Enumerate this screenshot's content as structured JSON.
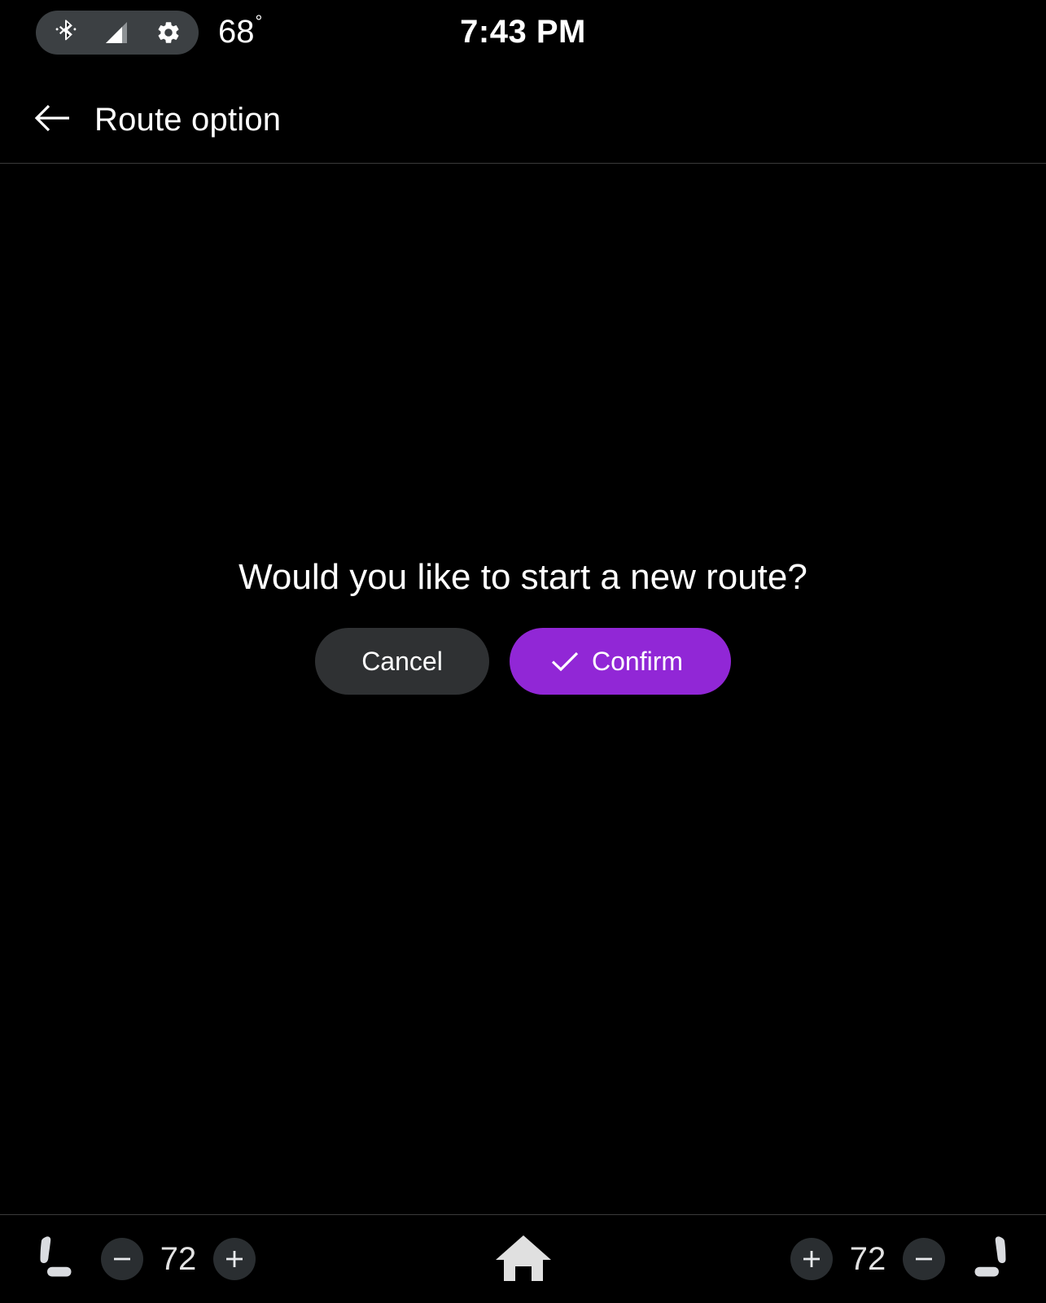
{
  "status_bar": {
    "icons": [
      {
        "name": "bluetooth-icon",
        "label": "Bluetooth"
      },
      {
        "name": "cellular-signal-icon",
        "label": "Cellular signal"
      },
      {
        "name": "settings-gear-icon",
        "label": "Settings"
      }
    ],
    "pill_color": "#3c4043",
    "temperature": "68",
    "temperature_degree": "°",
    "clock": "7:43 PM"
  },
  "app_bar": {
    "back_icon": "arrow-left-icon",
    "title": "Route option"
  },
  "dialog": {
    "message": "Would you like to start a new route?",
    "cancel_label": "Cancel",
    "confirm_label": "Confirm",
    "confirm_icon": "check-icon",
    "cancel_color": "#2f3133",
    "confirm_color": "#9127D6"
  },
  "bottom_bar": {
    "left_climate": {
      "seat_icon": "seat-icon",
      "decrease_label": "−",
      "temperature": "72",
      "increase_label": "+"
    },
    "home_icon": "home-icon",
    "right_climate": {
      "increase_label": "+",
      "temperature": "72",
      "decrease_label": "−",
      "seat_icon": "seat-icon"
    },
    "button_color": "#2a2e31"
  }
}
